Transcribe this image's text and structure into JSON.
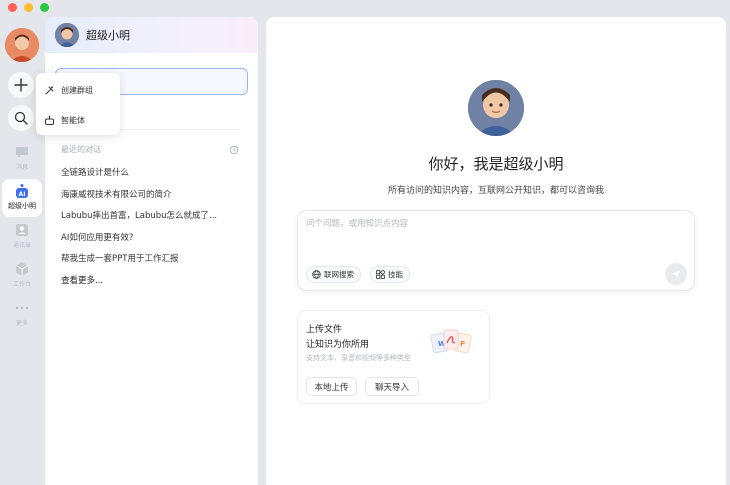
{
  "window": {
    "controls": [
      "close",
      "minimize",
      "zoom"
    ]
  },
  "rail": {
    "items": [
      {
        "label": "消息",
        "icon": "chat-bubble-icon"
      },
      {
        "label": "超级小明",
        "icon": "ai-robot-icon",
        "active": true
      },
      {
        "label": "通讯录",
        "icon": "contacts-icon"
      },
      {
        "label": "工作台",
        "icon": "workspace-icon"
      },
      {
        "label": "更多",
        "icon": "more-dots-icon"
      }
    ]
  },
  "popup": {
    "items": [
      {
        "label": "创建群组",
        "icon": "create-group-icon"
      },
      {
        "label": "智能体",
        "icon": "agent-icon"
      }
    ]
  },
  "panel": {
    "title": "超级小明",
    "recent_label": "最近的对话",
    "conversations": [
      "全链路设计是什么",
      "海康威视技术有限公司的简介",
      "Labubu摔出首富，Labubu怎么就成了...",
      "AI如何应用更有效?",
      "帮我生成一套PPT用于工作汇报"
    ],
    "more": "查看更多..."
  },
  "main": {
    "title": "你好，我是超级小明",
    "subtitle": "所有访问的知识内容，互联网公开知识，都可以咨询我",
    "composer": {
      "placeholder": "问个问题，或用知识点内容",
      "web_search": "联网搜索",
      "skills": "技能"
    },
    "upload": {
      "title": "上传文件",
      "subtitle": "让知识为你所用",
      "hint": "支持文本、录音和视频等多种类型",
      "local_button": "本地上传",
      "chat_import_button": "聊天导入"
    }
  },
  "colors": {
    "accent": "#4b7bf5",
    "active_rail": "#3d6ff0",
    "background": "#e4e6eb"
  }
}
